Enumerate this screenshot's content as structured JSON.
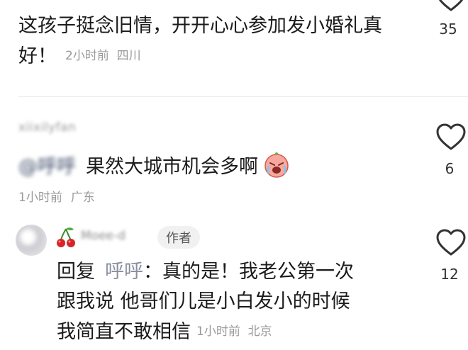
{
  "comments": [
    {
      "text": "这孩子挺念旧情，开开心心参加发小婚礼真好！",
      "time": "2小时前",
      "location": "四川",
      "likes": "35"
    },
    {
      "username": "xiixilyfan",
      "mention": "@呼呼",
      "text": "果然大城市机会多啊",
      "emoji": "crying-laugh-emoji",
      "time": "1小时前",
      "location": "广东",
      "likes": "6"
    },
    {
      "username": "Moee-d",
      "author_tag": "作者",
      "reply_prefix": "回复",
      "reply_to": "呼呼",
      "reply_sep": "：",
      "text_line1": "真的是！我老公第一次",
      "text_line2": "跟我说 他哥们儿是小白发小的时候",
      "text_line3": "我简直不敢相信",
      "time": "1小时前",
      "location": "北京",
      "likes": "12"
    }
  ],
  "colors": {
    "primary_text": "#1b1b1b",
    "meta_text": "#9a9a9a",
    "mention": "#5b6b8a",
    "author_tag_bg": "#f1f1f1"
  }
}
